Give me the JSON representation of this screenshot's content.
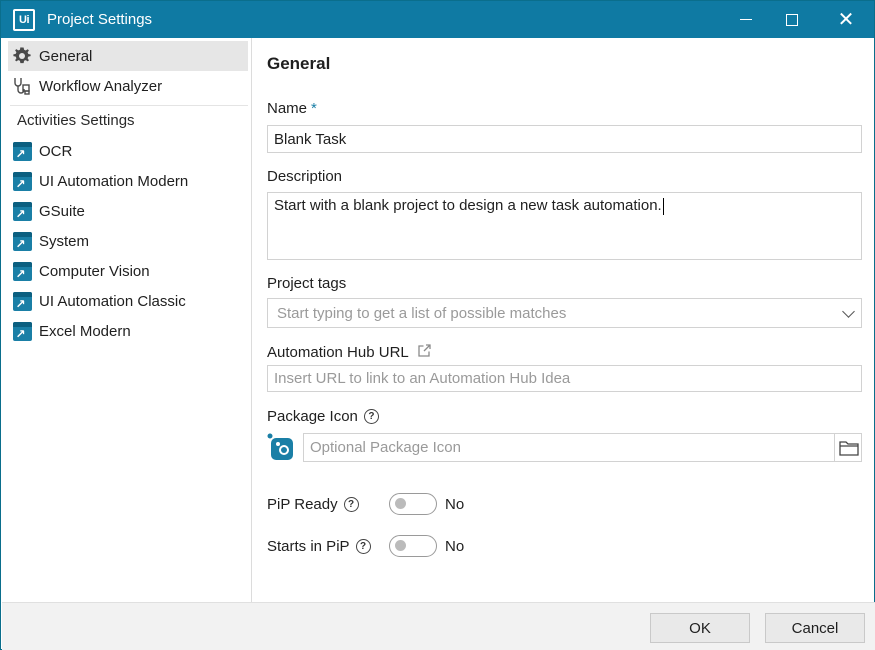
{
  "window": {
    "logo_text": "Ui",
    "title": "Project Settings"
  },
  "sidebar": {
    "items": [
      {
        "label": "General",
        "icon": "gear-icon"
      },
      {
        "label": "Workflow Analyzer",
        "icon": "workflow-analyzer-icon"
      }
    ],
    "heading": "Activities Settings",
    "activities": [
      {
        "label": "OCR",
        "icon": "package-icon"
      },
      {
        "label": "UI Automation Modern",
        "icon": "package-icon"
      },
      {
        "label": "GSuite",
        "icon": "package-icon"
      },
      {
        "label": "System",
        "icon": "package-icon"
      },
      {
        "label": "Computer Vision",
        "icon": "package-icon"
      },
      {
        "label": "UI Automation Classic",
        "icon": "package-icon"
      },
      {
        "label": "Excel Modern",
        "icon": "package-icon"
      }
    ]
  },
  "main": {
    "title": "General",
    "name": {
      "label": "Name",
      "required_mark": "*",
      "value": "Blank Task"
    },
    "description": {
      "label": "Description",
      "value": "Start with a blank project to design a new task automation."
    },
    "tags": {
      "label": "Project tags",
      "placeholder": "Start typing to get a list of possible matches"
    },
    "hub_url": {
      "label": "Automation Hub URL",
      "placeholder": "Insert URL to link to an Automation Hub Idea"
    },
    "package_icon": {
      "label": "Package Icon",
      "placeholder": "Optional Package Icon"
    },
    "pip_ready": {
      "label": "PiP Ready",
      "value": "No"
    },
    "starts_in_pip": {
      "label": "Starts in PiP",
      "value": "No"
    }
  },
  "footer": {
    "ok_label": "OK",
    "cancel_label": "Cancel"
  },
  "colors": {
    "title_bar": "#0f7aa3",
    "accent": "#1a7fa6",
    "selected_bg": "#e6e6e6"
  }
}
